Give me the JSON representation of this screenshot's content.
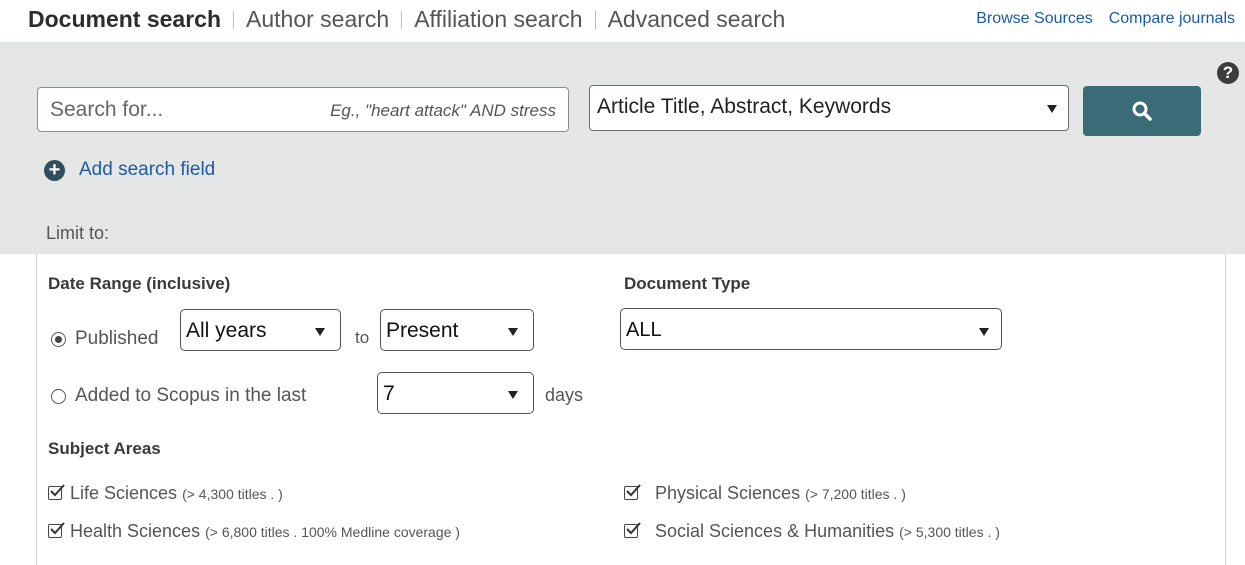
{
  "tabs": [
    {
      "label": "Document search"
    },
    {
      "label": "Author search"
    },
    {
      "label": "Affiliation search"
    },
    {
      "label": "Advanced search"
    }
  ],
  "top_links": {
    "browse": "Browse Sources",
    "compare": "Compare journals"
  },
  "help": {
    "symbol": "?"
  },
  "search": {
    "placeholder": "Search for...",
    "value": "",
    "hint": "Eg., \"heart attack\" AND stress",
    "field_selected": "Article Title, Abstract, Keywords",
    "icon": "search-icon"
  },
  "add_field": {
    "symbol": "+",
    "label": "Add search field"
  },
  "limit_to": "Limit to:",
  "date_range": {
    "heading": "Date Range (inclusive)",
    "published_label": "Published",
    "from_value": "All years",
    "to_label": "to",
    "to_value": "Present",
    "added_label": "Added to Scopus in the last",
    "days_value": "7",
    "days_label": "days"
  },
  "document_type": {
    "heading": "Document Type",
    "value": "ALL"
  },
  "subject_areas": {
    "heading": "Subject Areas",
    "items": [
      {
        "name": "Life Sciences",
        "count": "(> 4,300 titles . )",
        "checked": true
      },
      {
        "name": "Health Sciences",
        "count": "(> 6,800 titles . 100% Medline coverage )",
        "checked": true
      },
      {
        "name": "Physical Sciences",
        "count": "(> 7,200 titles . )",
        "checked": true
      },
      {
        "name": "Social Sciences & Humanities",
        "count": "(> 5,300 titles . )",
        "checked": true
      }
    ]
  },
  "colors": {
    "accent": "#1e6e7a",
    "button": "#3b6b77",
    "link": "#1c5aa6",
    "panel": "#e5e6e6"
  }
}
